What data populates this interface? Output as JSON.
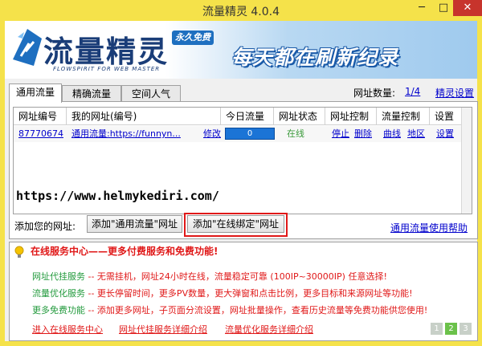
{
  "window": {
    "title": "流量精灵 4.0.4",
    "close": "✕",
    "minimize": "─",
    "maximize": "□"
  },
  "banner": {
    "brand": "流量精灵",
    "brand_sub": "FLOWSPIRIT FOR WEB MASTER",
    "badge": "永久免费",
    "slogan": "每天都在刷新纪录"
  },
  "tabs": [
    {
      "label": "通用流量"
    },
    {
      "label": "精确流量"
    },
    {
      "label": "空间人气"
    }
  ],
  "site_count": {
    "label": "网址数量:",
    "value": "1/4"
  },
  "settings_link": "精灵设置",
  "table": {
    "headers": [
      "网址编号",
      "我的网址(编号)",
      "今日流量",
      "网址状态",
      "网址控制",
      "流量控制",
      "设置"
    ],
    "rows": [
      {
        "id": "87770674",
        "url": "通用流量:https://funnyn...",
        "edit": "修改",
        "today": "0",
        "status": "在线",
        "stop": "停止",
        "delete": "删除",
        "curve": "曲线",
        "region": "地区",
        "settings": "设置"
      }
    ]
  },
  "overlay_url": "https://www.helmykediri.com/",
  "add": {
    "label": "添加您的网址:",
    "btn_general": "添加\"通用流量\"网址",
    "btn_online": "添加\"在线绑定\"网址",
    "help": "通用流量使用帮助"
  },
  "service": {
    "title": "在线服务中心——更多付费服务和免费功能!",
    "lines": [
      {
        "name": "网址代挂服务",
        "desc": " -- 无需挂机，网址24小时在线，流量稳定可靠 (100IP~30000IP) 任意选择!"
      },
      {
        "name": "流量优化服务",
        "desc": " -- 更长停留时间，更多PV数量，更大弹窗和点击比例，更多目标和来源网址等功能!"
      },
      {
        "name": "更多免费功能",
        "desc": " -- 添加更多网址，子页面分流设置，网址批量操作，查看历史流量等免费功能供您使用!"
      }
    ],
    "links": [
      "进入在线服务中心",
      "网址代挂服务详细介绍",
      "流量优化服务详细介绍"
    ],
    "pages": [
      "1",
      "2",
      "3"
    ]
  }
}
